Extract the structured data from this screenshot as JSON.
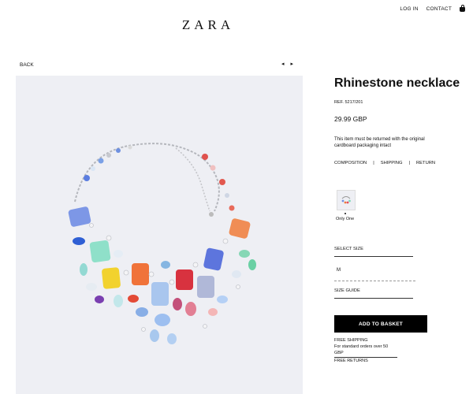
{
  "brand": "ZARA",
  "header": {
    "login": "LOG IN",
    "contact": "CONTACT"
  },
  "nav": {
    "back": "BACK",
    "prev_arrow": "◂",
    "next_arrow": "▸"
  },
  "product": {
    "title": "Rhinestone necklace",
    "ref": "REF. 5217/201",
    "price": "29.99 GBP",
    "note": "This item must be returned with the original cardboard packaging intact",
    "tabs": {
      "composition": "COMPOSITION",
      "sep1": "|",
      "shipping": "SHIPPING",
      "sep2": "|",
      "returns": "RETURN"
    },
    "variant_label": "Only One",
    "select_size": "SELECT SIZE",
    "size_value": "M",
    "size_guide": "SIZE GUIDE",
    "add_to_basket": "ADD TO BASKET",
    "free_shipping": "FREE SHIPPING",
    "shipping_condition": "For standard orders over 50 GBP",
    "free_returns": "FREE RETURNS"
  }
}
